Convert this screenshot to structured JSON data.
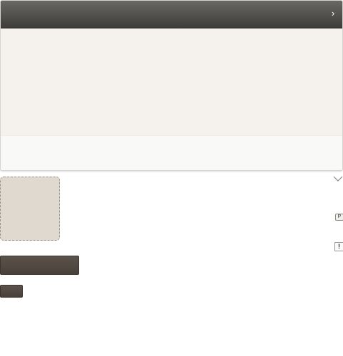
{
  "panel": {
    "header": {
      "title": "",
      "expand_icon": "chevron-right-icon"
    },
    "body_text": "",
    "footer_text": ""
  },
  "dropzone": {
    "label": ""
  },
  "controls": {
    "collapse_icon": "chevron-down-icon",
    "badge_icon_text": "P",
    "alert_icon_text": "!"
  },
  "buttons": {
    "primary_label": "",
    "secondary_label": ""
  },
  "colors": {
    "header_dark": "#3f3d3a",
    "body_bg": "#f5f2ed",
    "dropzone_bg": "#e0d9d0",
    "button_dark": "#4f4841"
  }
}
